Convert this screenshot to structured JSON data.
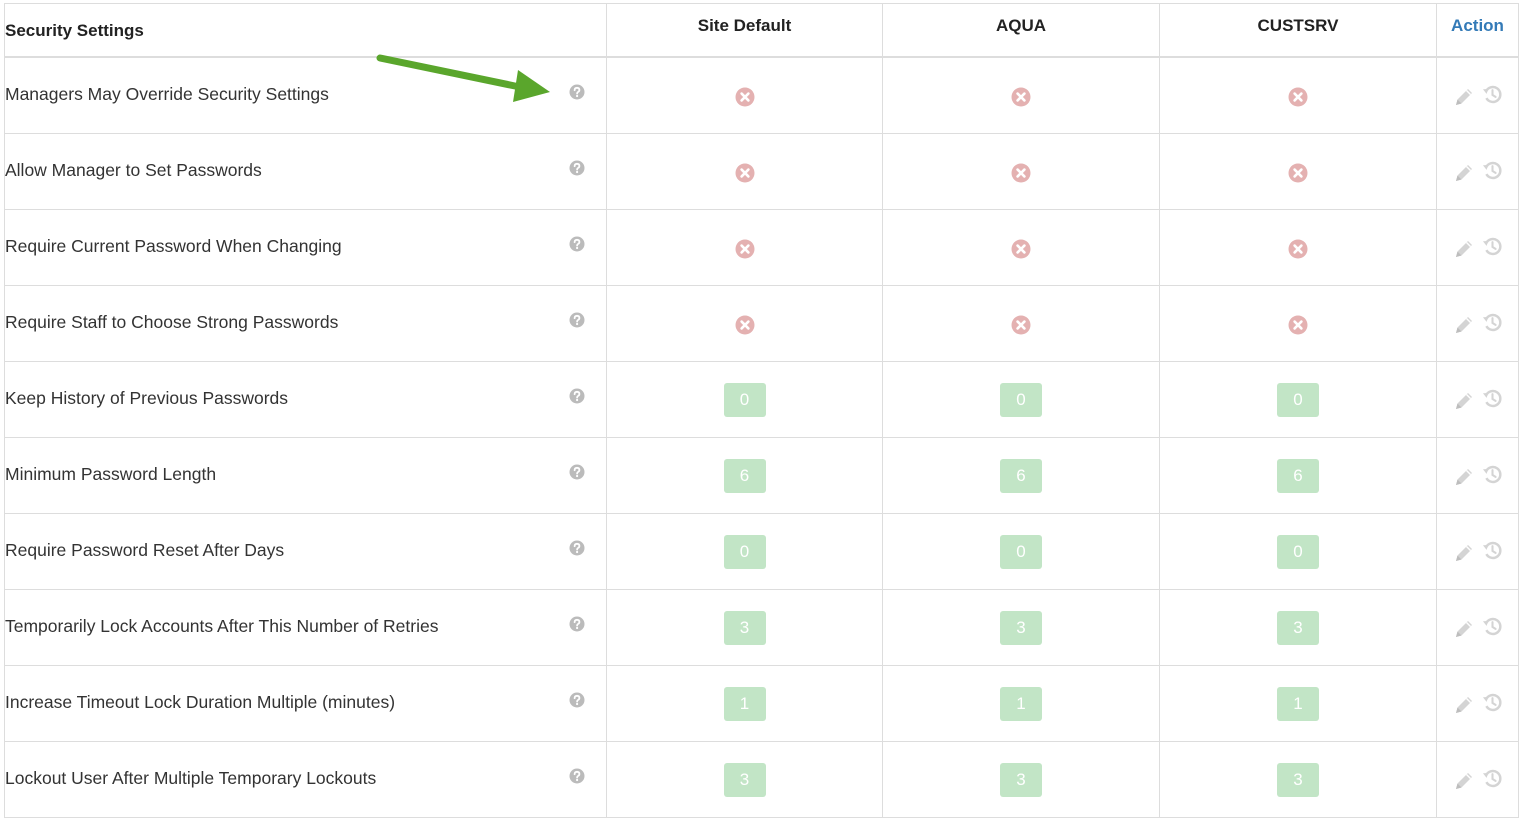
{
  "header": {
    "title": "Security Settings",
    "columns": [
      "Site Default",
      "AQUA",
      "CUSTSRV"
    ],
    "action_label": "Action"
  },
  "icons": {
    "help": "help-question-icon",
    "disabled": "x-circle-icon",
    "edit": "pencil-icon",
    "reset": "history-icon",
    "annotation": "green-arrow"
  },
  "colors": {
    "x_icon": "#e4b1b1",
    "badge": "#c2e5c6",
    "action_header": "#337ab7",
    "arrow": "#5aa62c"
  },
  "rows": [
    {
      "label": "Managers May Override Security Settings",
      "type": "bool",
      "values": [
        "off",
        "off",
        "off"
      ]
    },
    {
      "label": "Allow Manager to Set Passwords",
      "type": "bool",
      "values": [
        "off",
        "off",
        "off"
      ]
    },
    {
      "label": "Require Current Password When Changing",
      "type": "bool",
      "values": [
        "off",
        "off",
        "off"
      ]
    },
    {
      "label": "Require Staff to Choose Strong Passwords",
      "type": "bool",
      "values": [
        "off",
        "off",
        "off"
      ]
    },
    {
      "label": "Keep History of Previous Passwords",
      "type": "number",
      "values": [
        "0",
        "0",
        "0"
      ]
    },
    {
      "label": "Minimum Password Length",
      "type": "number",
      "values": [
        "6",
        "6",
        "6"
      ]
    },
    {
      "label": "Require Password Reset After Days",
      "type": "number",
      "values": [
        "0",
        "0",
        "0"
      ]
    },
    {
      "label": "Temporarily Lock Accounts After This Number of Retries",
      "type": "number",
      "values": [
        "3",
        "3",
        "3"
      ]
    },
    {
      "label": "Increase Timeout Lock Duration Multiple (minutes)",
      "type": "number",
      "values": [
        "1",
        "1",
        "1"
      ]
    },
    {
      "label": "Lockout User After Multiple Temporary Lockouts",
      "type": "number",
      "values": [
        "3",
        "3",
        "3"
      ]
    }
  ]
}
